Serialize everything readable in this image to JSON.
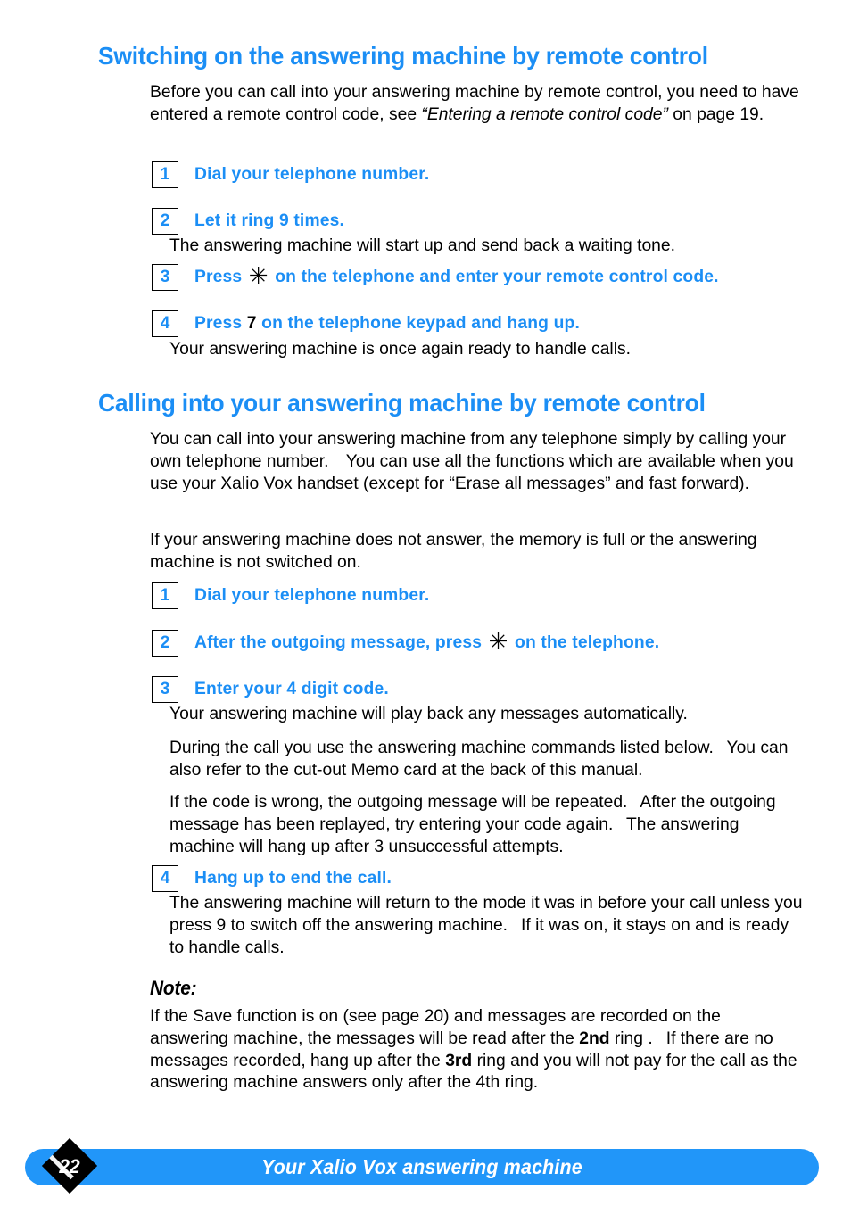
{
  "sections": [
    {
      "heading": "Switching on the answering machine by remote control",
      "intro": "Before you can call into your answering machine by remote control, you need to have entered a remote control code, see ",
      "intro_italic": "“Entering a remote control code”",
      "intro_tail": " on page 19.",
      "steps": [
        {
          "num": "1",
          "pre": "Dial your telephone number.",
          "key": "",
          "post": "",
          "detail": ""
        },
        {
          "num": "2",
          "pre": "Let it ring 9 times.",
          "key": "",
          "post": "",
          "detail": "The answering machine will start up and send back a waiting tone."
        },
        {
          "num": "3",
          "pre": "Press ",
          "key": "✳",
          "post": " on the telephone and enter your remote control code.",
          "detail": ""
        },
        {
          "num": "4",
          "pre": "Press ",
          "key": "7",
          "post": " on the telephone keypad and hang up.",
          "detail": "Your answering machine is once again ready to handle calls."
        }
      ]
    },
    {
      "heading": "Calling into your answering machine by remote control",
      "para1": "You can call into your answering machine from any telephone simply by calling your own telephone number. You can use all the functions which are available when you use your Xalio Vox handset (except for “Erase all messages” and fast forward).",
      "para2": "If your answering machine does not answer, the memory is full or the answering machine is not switched on.",
      "steps": [
        {
          "num": "1",
          "pre": "Dial your telephone number.",
          "key": "",
          "post": "",
          "detail": ""
        },
        {
          "num": "2",
          "pre": "After the outgoing message, press ",
          "key": "✳",
          "post": " on the telephone.",
          "detail": ""
        },
        {
          "num": "3",
          "pre": "Enter your 4 digit code.",
          "key": "",
          "post": "",
          "detail": "Your answering machine will play back any messages automatically."
        },
        {
          "num": "4",
          "pre": "Hang up to end the call.",
          "key": "",
          "post": "",
          "detail": ""
        }
      ],
      "body_para1": "During the call you use the answering machine commands listed below.  You can also refer to the cut-out Memo card at the back of this manual.",
      "body_para2": "If the code is wrong, the outgoing message will be repeated.  After the outgoing message has been replayed, try entering your code again.  The answering machine will hang up after 3 unsuccessful attempts.",
      "step4_detail": "The answering machine will return to the mode it was in before your call unless you press 9 to switch off the answering machine.  If it was on, it stays on and is ready to handle calls."
    }
  ],
  "note": {
    "heading": "Note:",
    "text_a": "If the Save function is on (see page 20) and messages are recorded on the answering machine, the messages will be read after the ",
    "bold_a": "2nd",
    "text_b": " ring .  If there are no messages recorded, hang up after the ",
    "bold_b": "3rd",
    "text_c": " ring and you will not pay for the call as the answering machine answers only after the 4th ring."
  },
  "footer": {
    "title": "Your Xalio Vox answering machine",
    "page_number": "22"
  },
  "colors": {
    "accent_blue": "#1b8ef5",
    "footer_blue": "#2196f9",
    "text_black": "#000000",
    "badge_black": "#000000"
  }
}
